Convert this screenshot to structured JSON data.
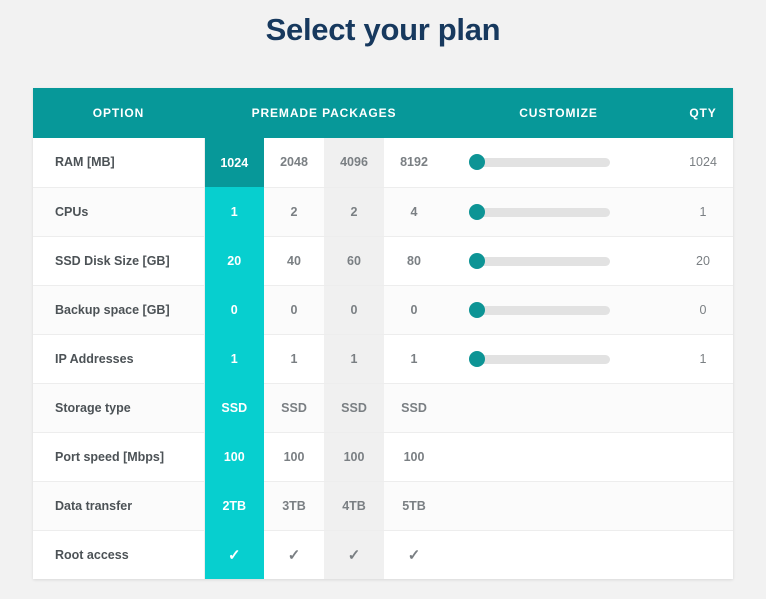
{
  "page": {
    "title": "Select your plan",
    "background_color": "#f2f2f2",
    "title_color": "#17395e"
  },
  "colors": {
    "header_teal": "#079899",
    "selected_bright": "#07cfcf",
    "slider_handle": "#0d9495",
    "gray_column": "#f0f0f0"
  },
  "table": {
    "headers": {
      "option": "OPTION",
      "premade": "PREMADE PACKAGES",
      "customize": "CUSTOMIZE",
      "qty": "QTY"
    },
    "rows": [
      {
        "label": "RAM [MB]",
        "packages": [
          "1024",
          "2048",
          "4096",
          "8192"
        ],
        "selected_index": 0,
        "selected_style": "dark",
        "has_slider": true,
        "slider_value": 0,
        "qty": "1024"
      },
      {
        "label": "CPUs",
        "packages": [
          "1",
          "2",
          "2",
          "4"
        ],
        "selected_index": 0,
        "selected_style": "bright",
        "has_slider": true,
        "slider_value": 0,
        "qty": "1"
      },
      {
        "label": "SSD Disk Size [GB]",
        "packages": [
          "20",
          "40",
          "60",
          "80"
        ],
        "selected_index": 0,
        "selected_style": "bright",
        "has_slider": true,
        "slider_value": 0,
        "qty": "20"
      },
      {
        "label": "Backup space [GB]",
        "packages": [
          "0",
          "0",
          "0",
          "0"
        ],
        "selected_index": 0,
        "selected_style": "bright",
        "has_slider": true,
        "slider_value": 0,
        "qty": "0"
      },
      {
        "label": "IP Addresses",
        "packages": [
          "1",
          "1",
          "1",
          "1"
        ],
        "selected_index": 0,
        "selected_style": "bright",
        "has_slider": true,
        "slider_value": 0,
        "qty": "1"
      },
      {
        "label": "Storage type",
        "packages": [
          "SSD",
          "SSD",
          "SSD",
          "SSD"
        ],
        "selected_index": 0,
        "selected_style": "bright",
        "has_slider": false,
        "qty": ""
      },
      {
        "label": "Port speed [Mbps]",
        "packages": [
          "100",
          "100",
          "100",
          "100"
        ],
        "selected_index": 0,
        "selected_style": "bright",
        "has_slider": false,
        "qty": ""
      },
      {
        "label": "Data transfer",
        "packages": [
          "2TB",
          "3TB",
          "4TB",
          "5TB"
        ],
        "selected_index": 0,
        "selected_style": "bright",
        "has_slider": false,
        "qty": ""
      },
      {
        "label": "Root access",
        "packages": [
          "✓",
          "✓",
          "✓",
          "✓"
        ],
        "selected_index": 0,
        "selected_style": "bright",
        "has_slider": false,
        "qty": ""
      }
    ],
    "gray_package_column_index": 2
  }
}
